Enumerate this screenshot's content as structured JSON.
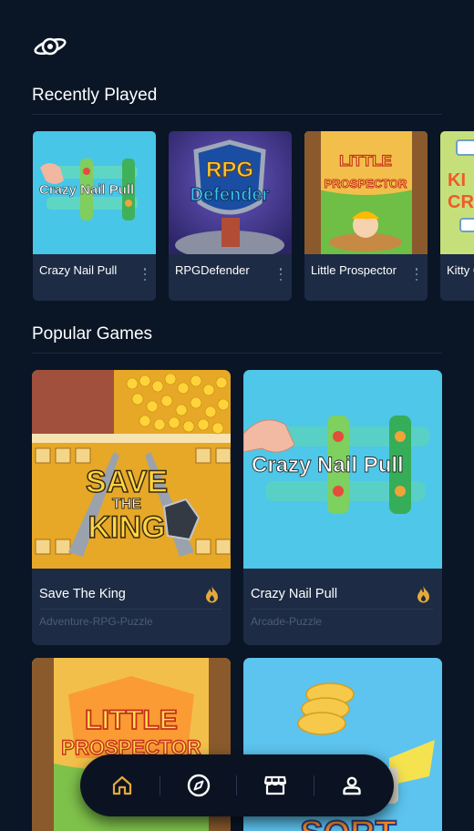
{
  "app": {
    "logo_icon": "planet-eye-icon"
  },
  "recently_played": {
    "title": "Recently Played",
    "items": [
      {
        "name": "Crazy Nail Pull",
        "art_text": "Crazy Nail Pull"
      },
      {
        "name": "RPGDefender",
        "art_text_1": "RPG",
        "art_text_2": "Defender"
      },
      {
        "name": "Little Prospector",
        "art_text_1": "LITTLE",
        "art_text_2": "PROSPECTOR"
      },
      {
        "name": "Kitty C",
        "art_text_1": "KI",
        "art_text_2": "CR"
      }
    ]
  },
  "popular_games": {
    "title": "Popular Games",
    "items": [
      {
        "name": "Save The King",
        "genre": "Adventure-RPG-Puzzle",
        "art_text_1": "SAVE",
        "art_text_2": "THE",
        "art_text_3": "KING"
      },
      {
        "name": "Crazy Nail Pull",
        "genre": "Arcade-Puzzle",
        "art_text": "Crazy Nail Pull"
      },
      {
        "art_text_1": "LITTLE",
        "art_text_2": "PROSPECTOR"
      },
      {
        "art_text": "SORT"
      }
    ]
  },
  "bottom_nav": {
    "items": [
      "home-icon",
      "compass-icon",
      "store-icon",
      "profile-icon"
    ],
    "active": "home-icon"
  },
  "colors": {
    "background": "#0a1526",
    "card": "#1d2b44",
    "accent": "#e3a93a",
    "muted": "#4c5d79"
  }
}
